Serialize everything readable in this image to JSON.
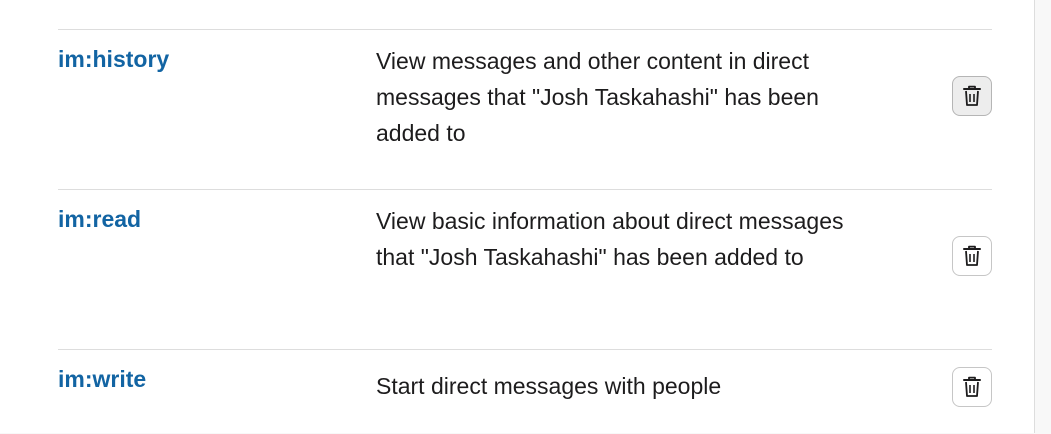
{
  "scopes": [
    {
      "name": "im:history",
      "description": "View messages and other content in direct messages that \"Josh Taskahashi\" has been added to",
      "remove_icon": "trash-icon"
    },
    {
      "name": "im:read",
      "description": "View basic information about direct messages that \"Josh Taskahashi\" has been added to",
      "remove_icon": "trash-icon"
    },
    {
      "name": "im:write",
      "description": "Start direct messages with people",
      "remove_icon": "trash-icon"
    }
  ],
  "colors": {
    "scope_link": "#1264a3",
    "text": "#1d1c1d",
    "divider": "#dddddd",
    "button_hover_bg": "#ededed"
  }
}
